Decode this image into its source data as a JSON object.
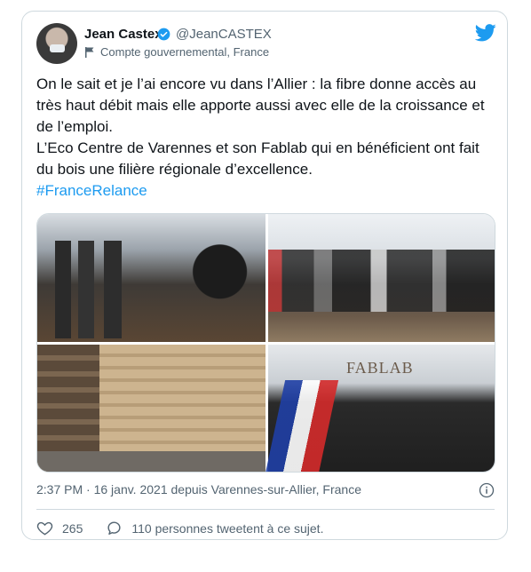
{
  "author": {
    "name": "Jean Castex",
    "handle": "@JeanCASTEX",
    "label": "Compte gouvernemental, France"
  },
  "tweet": {
    "line1": "On le sait et je l’ai encore vu dans l’Allier : la fibre donne accès au très haut débit mais elle apporte aussi avec elle de la croissance et de l’emploi.",
    "line2": "L’Eco Centre de Varennes et son Fablab qui en bénéficient ont fait du bois une filière régionale d’excellence.",
    "hashtag": "#FranceRelance"
  },
  "media": {
    "photo4_sign": "FABLAB"
  },
  "meta": {
    "timestamp": "2:37 PM · 16 janv. 2021 depuis Varennes-sur-Allier, France"
  },
  "actions": {
    "likes": "265",
    "conversation": "110 personnes tweetent à ce sujet."
  },
  "colors": {
    "accent": "#1d9bf0",
    "verified": "#1d9bf0",
    "secondary_text": "#536471"
  },
  "icons": [
    "verified-icon",
    "government-flag-icon",
    "twitter-bird-icon",
    "info-icon",
    "heart-icon",
    "reply-bubble-icon"
  ]
}
